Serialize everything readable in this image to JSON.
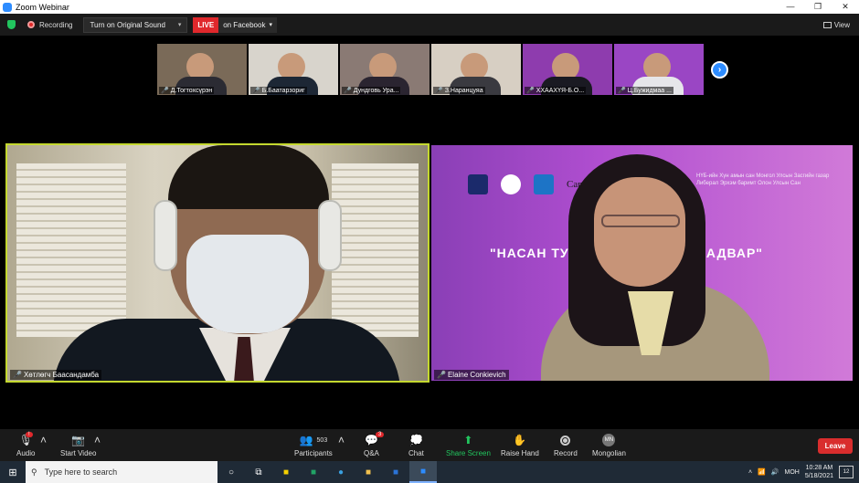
{
  "window": {
    "title": "Zoom Webinar",
    "controls": [
      "—",
      "❐",
      "✕"
    ]
  },
  "topbar": {
    "recording_label": "Recording",
    "original_sound_label": "Turn on Original Sound",
    "live_badge": "LIVE",
    "live_target": "on Facebook",
    "view_label": "View"
  },
  "thumbnails": [
    {
      "name": "Д.Тогтохсүрэн",
      "bg": "#7a6a58",
      "shirt": "#2b2b33"
    },
    {
      "name": "Б.Баатарзориг",
      "bg": "#d8d4cc",
      "shirt": "#1d2735"
    },
    {
      "name": "Дундговь Ура...",
      "bg": "#8a7a74",
      "shirt": "#2a2430"
    },
    {
      "name": "З.Наранцуяа",
      "bg": "#d7cfc3",
      "shirt": "#3a3a40"
    },
    {
      "name": "ХХААХҮЯ-Б.О...",
      "bg": "#8e3cae",
      "shirt": "#1a1a22"
    },
    {
      "name": "Ц.Бужидмаа ...",
      "bg": "#9a46c4",
      "shirt": "#e6e6ea"
    }
  ],
  "main_videos": {
    "left_name": "Хөтлөгч Баасандамба",
    "right_name": "Elaine Conkievich",
    "right_slide": {
      "logo_text": "Canada",
      "subtitle": "НҮБ-ийн Хүн амын сан Монгол Улсын Засгийн газар Либерал Эрхэм баримт Олон Улсын Сан",
      "banner_left": "\"НАСАН ТУ",
      "banner_right": "ЧАДВАР\""
    }
  },
  "toolbar": {
    "audio": "Audio",
    "audio_badge": "!",
    "video": "Start Video",
    "participants": "Participants",
    "participants_count": "503",
    "qa": "Q&A",
    "qa_badge": "3",
    "chat": "Chat",
    "share": "Share Screen",
    "raise": "Raise Hand",
    "record": "Record",
    "language": "Mongolian",
    "language_abbr": "MN",
    "leave": "Leave"
  },
  "taskbar": {
    "search_placeholder": "Type here to search",
    "lang": "МОН",
    "time": "10:28 AM",
    "date": "5/18/2021",
    "notifications": "12"
  },
  "colors": {
    "active_speaker_border": "#c4d82f",
    "live_red": "#e0282c",
    "zoom_blue": "#2d8cff",
    "leave_red": "#d92d2d"
  }
}
